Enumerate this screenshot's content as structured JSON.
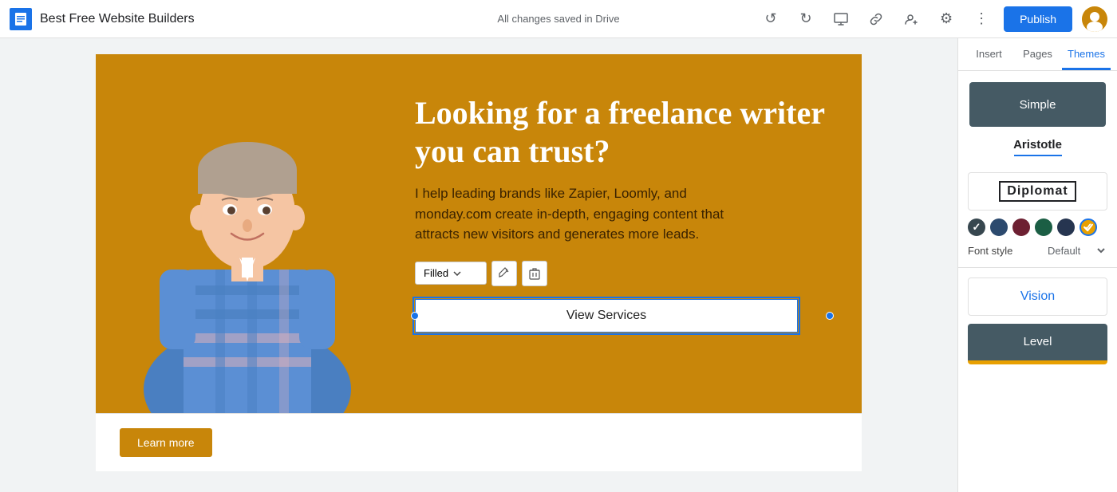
{
  "topbar": {
    "doc_title": "Best Free Website Builders",
    "save_status": "All changes saved in Drive",
    "publish_label": "Publish"
  },
  "panel": {
    "tabs": [
      {
        "label": "Insert",
        "id": "insert"
      },
      {
        "label": "Pages",
        "id": "pages"
      },
      {
        "label": "Themes",
        "id": "themes",
        "active": true
      }
    ],
    "themes": [
      {
        "id": "simple",
        "label": "Simple"
      },
      {
        "id": "aristotle",
        "label": "Aristotle",
        "selected": true
      },
      {
        "id": "diplomat",
        "label": "Diplomat"
      },
      {
        "id": "vision",
        "label": "Vision"
      },
      {
        "id": "level",
        "label": "Level"
      }
    ],
    "color_swatches": [
      {
        "color": "#37474f",
        "selected": false
      },
      {
        "color": "#2c4a6e",
        "selected": false
      },
      {
        "color": "#6d2032",
        "selected": false
      },
      {
        "color": "#1b5e44",
        "selected": false
      },
      {
        "color": "#263550",
        "selected": false
      },
      {
        "color": "#e8a000",
        "selected": true
      }
    ],
    "font_style_label": "Font style",
    "font_style_value": ""
  },
  "hero": {
    "headline": "Looking for a freelance writer you can trust?",
    "body_text": "I help leading brands like Zapier, Loomly, and monday.com create in-depth, engaging content that attracts new visitors and generates more leads.",
    "cta_label": "View Services",
    "btn_style": "Filled"
  },
  "below_hero": {
    "learn_more_label": "Learn more"
  }
}
